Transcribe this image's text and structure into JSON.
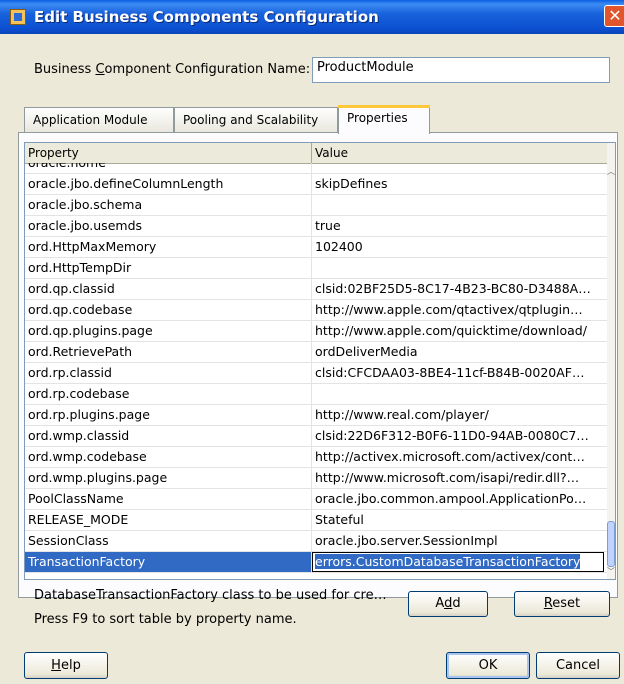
{
  "window": {
    "title": "Edit Business Components Configuration",
    "close_label": "✕"
  },
  "config_name": {
    "label_pre": "Business ",
    "label_mnemonic": "C",
    "label_post": "omponent Configuration Name:",
    "value": "ProductModule"
  },
  "tabs": [
    {
      "label": "Application Module",
      "active": false
    },
    {
      "label": "Pooling and Scalability",
      "active": false
    },
    {
      "label": "Properties",
      "active": true
    }
  ],
  "table": {
    "headers": [
      "Property",
      "Value"
    ],
    "rows": [
      {
        "property": "oracle.home",
        "value": ""
      },
      {
        "property": "oracle.jbo.defineColumnLength",
        "value": "skipDefines"
      },
      {
        "property": "oracle.jbo.schema",
        "value": ""
      },
      {
        "property": "oracle.jbo.usemds",
        "value": "true"
      },
      {
        "property": "ord.HttpMaxMemory",
        "value": "102400"
      },
      {
        "property": "ord.HttpTempDir",
        "value": ""
      },
      {
        "property": "ord.qp.classid",
        "value": "clsid:02BF25D5-8C17-4B23-BC80-D3488A…"
      },
      {
        "property": "ord.qp.codebase",
        "value": "http://www.apple.com/qtactivex/qtplugin…"
      },
      {
        "property": "ord.qp.plugins.page",
        "value": "http://www.apple.com/quicktime/download/"
      },
      {
        "property": "ord.RetrievePath",
        "value": "ordDeliverMedia"
      },
      {
        "property": "ord.rp.classid",
        "value": "clsid:CFCDAA03-8BE4-11cf-B84B-0020AF…"
      },
      {
        "property": "ord.rp.codebase",
        "value": ""
      },
      {
        "property": "ord.rp.plugins.page",
        "value": "http://www.real.com/player/"
      },
      {
        "property": "ord.wmp.classid",
        "value": "clsid:22D6F312-B0F6-11D0-94AB-0080C7…"
      },
      {
        "property": "ord.wmp.codebase",
        "value": "http://activex.microsoft.com/activex/cont…"
      },
      {
        "property": "ord.wmp.plugins.page",
        "value": "http://www.microsoft.com/isapi/redir.dll?…"
      },
      {
        "property": "PoolClassName",
        "value": "oracle.jbo.common.ampool.ApplicationPo…"
      },
      {
        "property": "RELEASE_MODE",
        "value": "Stateful"
      },
      {
        "property": "SessionClass",
        "value": "oracle.jbo.server.SessionImpl"
      }
    ],
    "selected_row": {
      "property": "TransactionFactory",
      "value": "errors.CustomDatabaseTransactionFactory"
    }
  },
  "description": "DatabaseTransactionFactory class to be used for cre…",
  "hint": "Press F9 to sort table by property name.",
  "buttons": {
    "add": {
      "pre": "A",
      "mnemonic": "d",
      "post": "d"
    },
    "reset": {
      "pre": "",
      "mnemonic": "R",
      "post": "eset"
    },
    "help": {
      "pre": "",
      "mnemonic": "H",
      "post": "elp"
    },
    "ok": "OK",
    "cancel": "Cancel"
  },
  "colors": {
    "title_bar": "#0b4fd0",
    "selection": "#316ac5",
    "dialog_bg": "#ece9d8",
    "active_tab_marker": "#ffc73c"
  },
  "icons": {
    "title": "app-window-icon",
    "close": "close-icon"
  }
}
